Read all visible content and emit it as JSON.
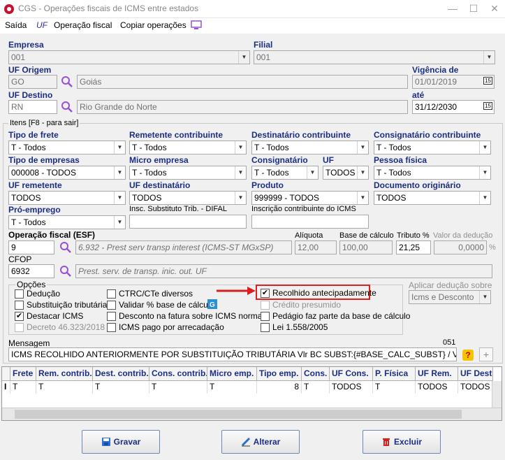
{
  "window": {
    "title": "CGS - Operações fiscais de ICMS entre estados"
  },
  "menu": {
    "saida": "Saída",
    "uf": "UF",
    "operacao_fiscal": "Operação fiscal",
    "copiar": "Copiar operações"
  },
  "header": {
    "empresa_label": "Empresa",
    "empresa_value": "001",
    "filial_label": "Filial",
    "filial_value": "001",
    "uf_origem_label": "UF Origem",
    "uf_origem_value": "GO",
    "uf_origem_name": "Goiás",
    "vigencia_label": "Vigência de",
    "vigencia_value": "01/01/2019",
    "uf_destino_label": "UF Destino",
    "uf_destino_value": "RN",
    "uf_destino_name": "Rio Grande do Norte",
    "ate_label": "até",
    "ate_value": "31/12/2030",
    "cal_glyph": "15"
  },
  "itens": {
    "legend": "Itens [F8 - para sair]",
    "tipo_frete_label": "Tipo de frete",
    "tipo_frete_value": "T - Todos",
    "remetente_label": "Remetente contribuinte",
    "remetente_value": "T - Todos",
    "destinatario_label": "Destinatário contribuinte",
    "destinatario_value": "T - Todos",
    "consignatario_label": "Consignatário contribuinte",
    "consignatario_value": "T - Todos",
    "tipo_empresas_label": "Tipo de empresas",
    "tipo_empresas_value": "000008 - TODOS",
    "micro_label": "Micro empresa",
    "micro_value": "T - Todos",
    "consig_label": "Consignatário",
    "consig_value": "T - Todos",
    "uf_label": "UF",
    "uf_value": "TODOS",
    "pessoa_label": "Pessoa física",
    "pessoa_value": "T - Todos",
    "uf_rem_label": "UF remetente",
    "uf_rem_value": "TODOS",
    "uf_dest_label": "UF destinatário",
    "uf_dest_value": "TODOS",
    "produto_label": "Produto",
    "produto_value": "999999 - TODOS",
    "doc_label": "Documento originário",
    "doc_value": "TODOS",
    "pro_emprego_label": "Pró-emprego",
    "pro_emprego_value": "T - Todos",
    "insc_st_label": "Insc. Substituto Trib. - DIFAL",
    "insc_contrib_label": "Inscrição contribuinte do ICMS",
    "op_fiscal_label": "Operação fiscal (ESF)",
    "op_fiscal_value": "9",
    "op_fiscal_desc": "6.932 - Prest serv transp interest (ICMS-ST MGxSP)",
    "aliquota_label": "Alíquota",
    "aliquota_value": "12,00",
    "base_label": "Base de cálculo",
    "base_value": "100,00",
    "tributo_label": "Tributo %",
    "tributo_value": "21,25",
    "deducao_label": "Valor da dedução",
    "deducao_value": "0,0000",
    "pct": "%",
    "cfop_label": "CFOP",
    "cfop_value": "6932",
    "cfop_desc": "Prest. serv. de transp. inic. out. UF"
  },
  "opcoes": {
    "legend": "Opções",
    "deducao": "Dedução",
    "subst": "Substituição tributária",
    "destacar": "Destacar ICMS",
    "decreto": "Decreto 46.323/2018",
    "ctrc": "CTRC/CTe diversos",
    "validar": "Validar % base de cálculo",
    "desconto": "Desconto na fatura sobre ICMS normal",
    "icms_pago": "ICMS pago por arrecadação",
    "recolhido": "Recolhido antecipadamente",
    "credito": "Crédito presumido",
    "pedagio": "Pedágio faz parte da base de cálculo",
    "lei": "Lei 1.558/2005",
    "check": "✔",
    "aplicar_label": "Aplicar dedução sobre",
    "aplicar_value": "Icms e Desconto"
  },
  "mensagem": {
    "label": "Mensagem",
    "count": "051",
    "value": "ICMS RECOLHIDO ANTERIORMENTE POR SUBSTITUIÇÃO TRIBUTÁRIA Vlr BC SUBST:{#BASE_CALC_SUBST} / VlrICMSSUBST",
    "help": "?",
    "plus": "+"
  },
  "grid": {
    "columns": [
      "Frete",
      "Rem. contrib.",
      "Dest. contrib.",
      "Cons. contrib.",
      "Micro emp.",
      "Tipo emp.",
      "Cons.",
      "UF Cons.",
      "P. Física",
      "UF Rem.",
      "UF Dest"
    ],
    "row": [
      "T",
      "T",
      "T",
      "T",
      "T",
      "8",
      "T",
      "TODOS",
      "T",
      "TODOS",
      "TODOS"
    ],
    "indicator": "I"
  },
  "buttons": {
    "gravar": "Gravar",
    "alterar": "Alterar",
    "excluir": "Excluir"
  },
  "colors": {
    "label": "#1b2e86",
    "highlight": "#e02020",
    "arrow": "#d81e1e",
    "magnifier": "#9a4fd8"
  }
}
